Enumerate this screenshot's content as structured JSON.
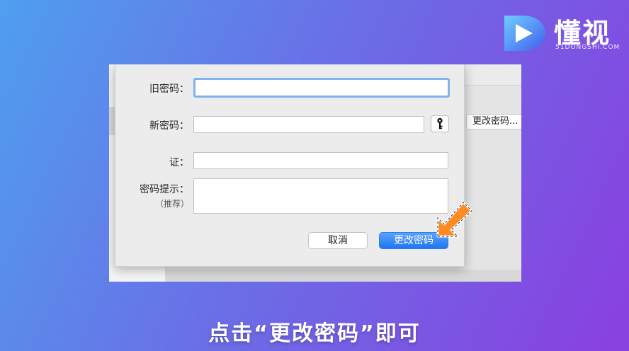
{
  "logo": {
    "brand": "懂视",
    "domain": "51DONGSHI.COM",
    "icon": "play-d-logo-icon"
  },
  "dialog": {
    "old_password_label": "旧密码：",
    "old_password_value": "",
    "new_password_label": "新密码：",
    "new_password_value": "",
    "verify_label": "证：",
    "verify_value": "",
    "hint_label": "密码提示：",
    "hint_sublabel": "（推荐）",
    "hint_value": "",
    "key_icon": "key-icon",
    "cancel_label": "取消",
    "confirm_label": "更改密码"
  },
  "background": {
    "change_password_button": "更改密码..."
  },
  "caption": "点击“更改密码”即可",
  "colors": {
    "accent": "#1f76ee",
    "focus_ring": "#7fb2ee",
    "arrow": "#ff8a1f"
  }
}
